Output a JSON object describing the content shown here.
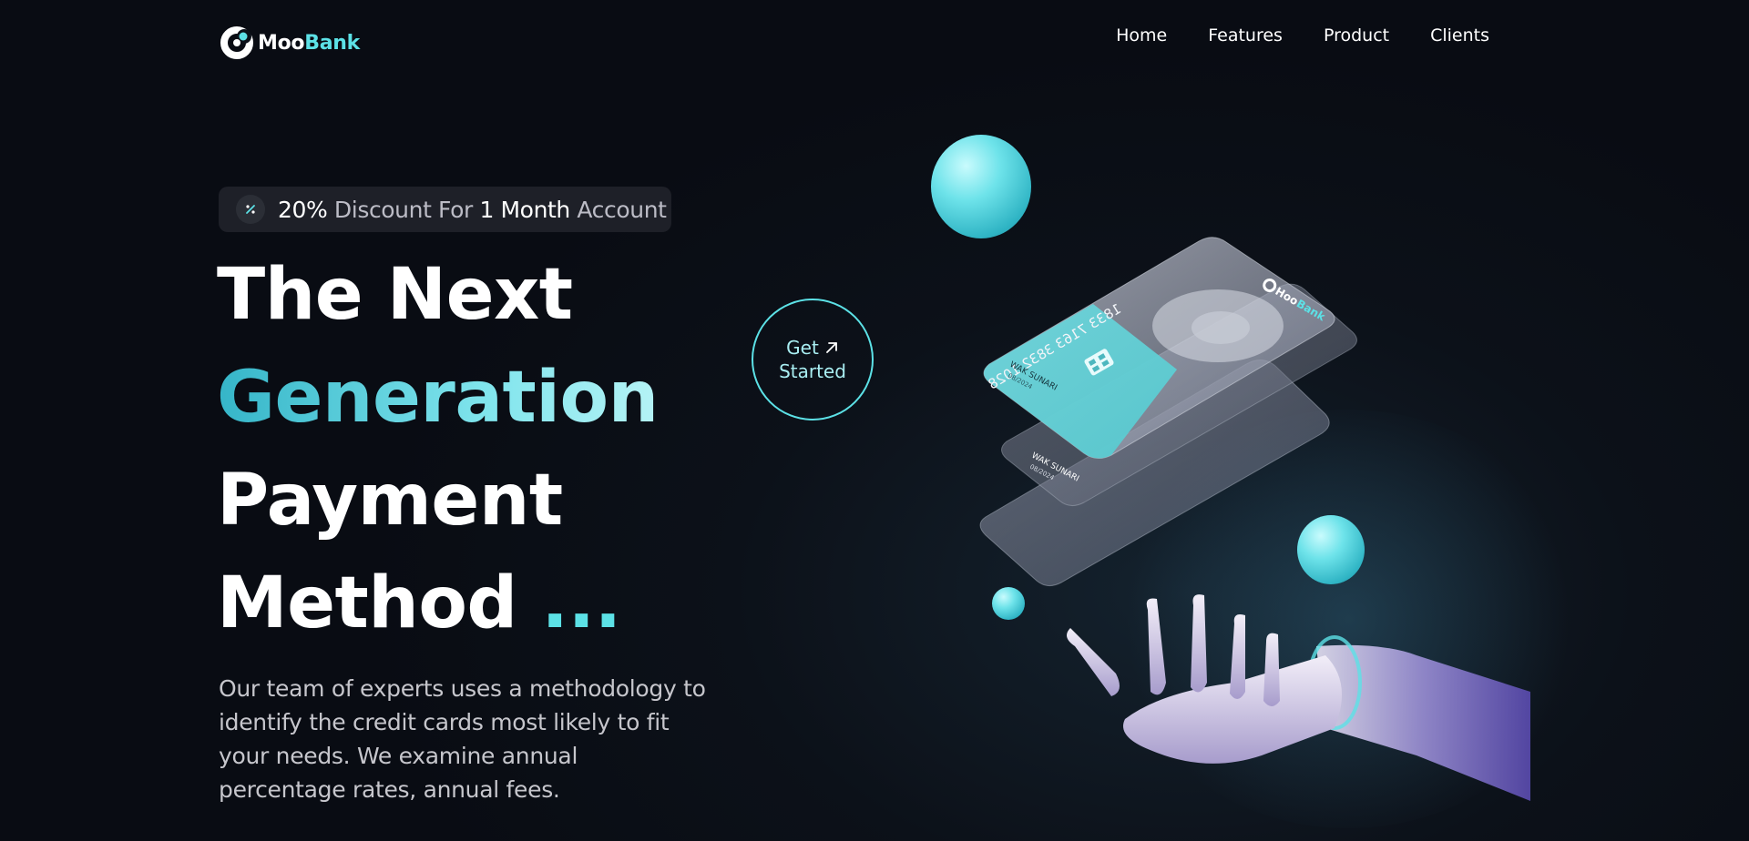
{
  "brand": {
    "name_part1": "Moo",
    "name_part2": "Bank"
  },
  "nav": {
    "items": [
      {
        "label": "Home"
      },
      {
        "label": "Features"
      },
      {
        "label": "Product"
      },
      {
        "label": "Clients"
      }
    ]
  },
  "promo": {
    "icon": "percent-icon",
    "value": "20%",
    "text1": "Discount",
    "text2": "For",
    "value2": "1 Month",
    "text3": "Account"
  },
  "hero": {
    "line1": "The Next",
    "line2": "Generation",
    "line3": "Payment",
    "line4": "Method",
    "dots": "...",
    "description": "Our team of experts uses a methodology to identify the credit cards most likely to fit your needs. We examine annual percentage rates, annual fees."
  },
  "cta": {
    "word1": "Get",
    "word2": "Started",
    "icon": "arrow-up-right-icon"
  },
  "card": {
    "number": "1833 7163 3832 1028",
    "holder": "WAK SUNARI",
    "expiry": "08/2024",
    "brand_part1": "Hoo",
    "brand_part2": "Bank"
  },
  "colors": {
    "accent": "#5ce1e6",
    "background": "#0c1119",
    "promo_bg": "#1e2028"
  }
}
